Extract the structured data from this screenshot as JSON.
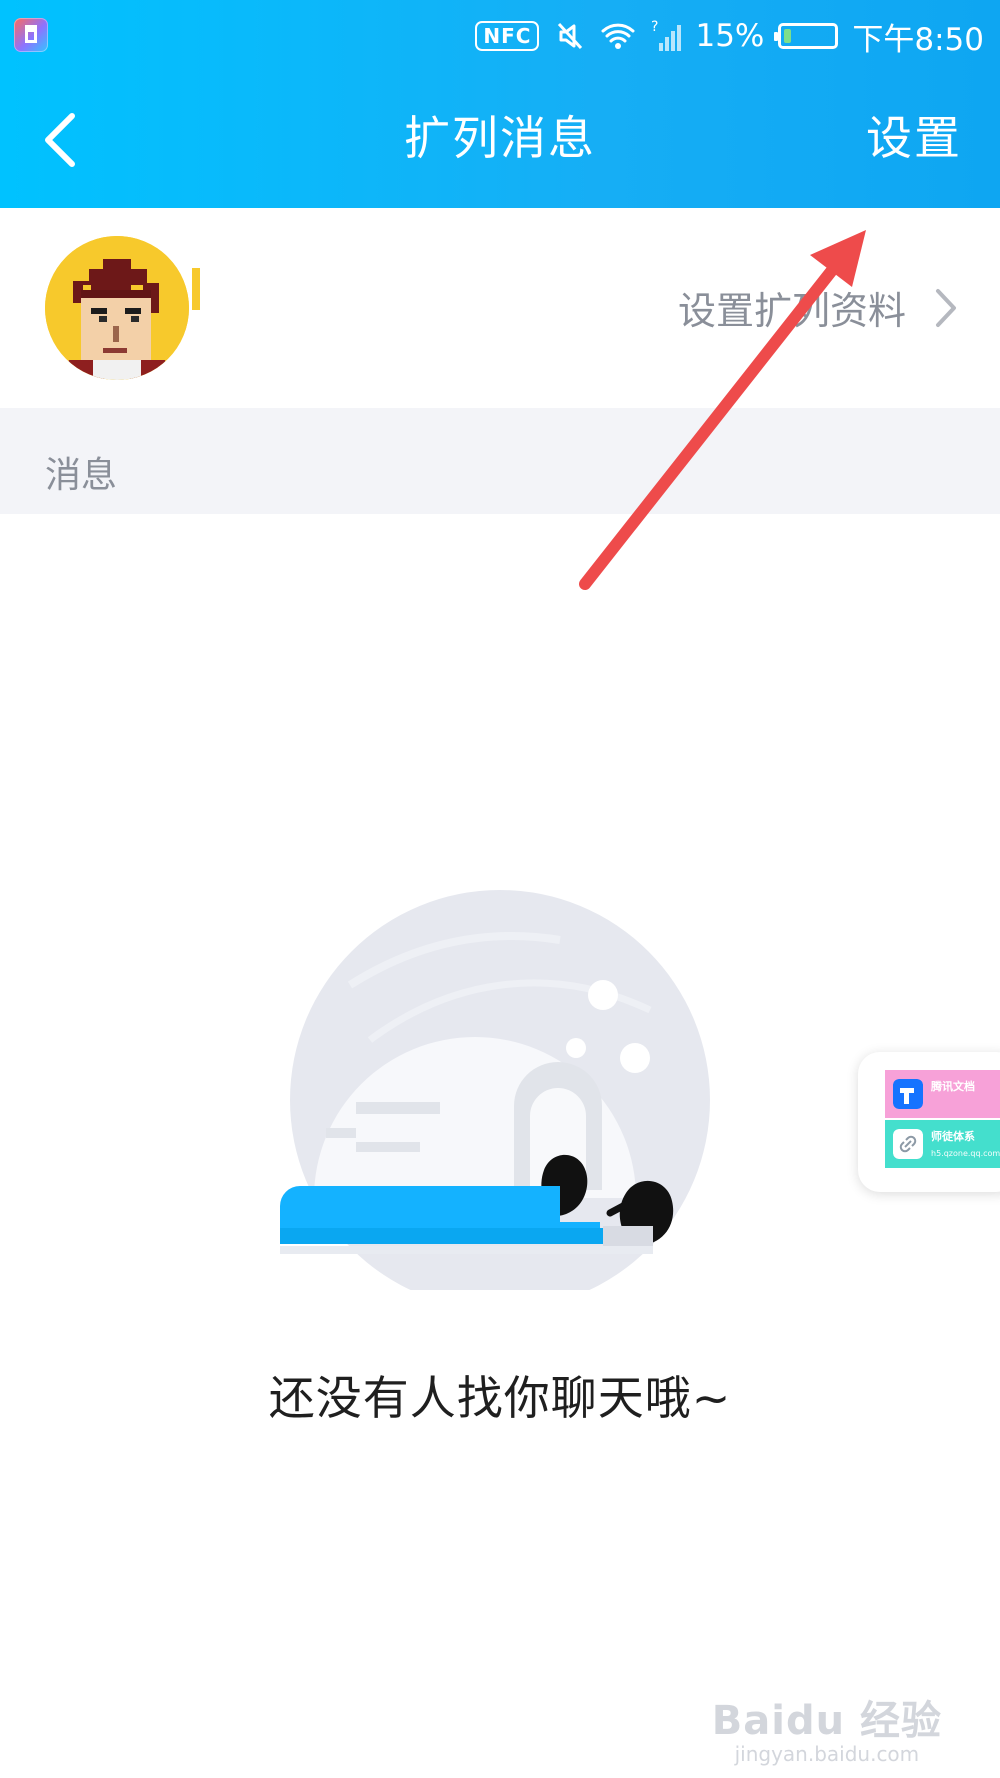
{
  "status_bar": {
    "nfc": "NFC",
    "battery_text": "15%",
    "battery_level": 0.15,
    "time": "下午8:50",
    "icons": [
      "app-icon",
      "nfc-icon",
      "mute-icon",
      "wifi-icon",
      "signal-icon",
      "battery-icon"
    ]
  },
  "nav": {
    "back_icon": "chevron-left-icon",
    "title": "扩列消息",
    "settings_label": "设置"
  },
  "profile": {
    "link_label": "设置扩列资料",
    "chevron_icon": "chevron-right-icon",
    "avatar_icon": "pixel-avatar"
  },
  "section": {
    "title": "消息"
  },
  "empty_state": {
    "message": "还没有人找你聊天哦~",
    "illustration": "igloo-penguins"
  },
  "floating_widget": {
    "items": [
      {
        "label": "腾讯文档",
        "sublabel": "",
        "icon": "tencent-docs-icon"
      },
      {
        "label": "师徒体系",
        "sublabel": "h5.qzone.qq.com",
        "icon": "link-icon"
      }
    ]
  },
  "watermark": {
    "main": "Baidu 经验",
    "sub": "jingyan.baidu.com"
  },
  "colors": {
    "header_start": "#00c2ff",
    "header_end": "#0ea6f2",
    "annotation": "#ee4b4b"
  }
}
